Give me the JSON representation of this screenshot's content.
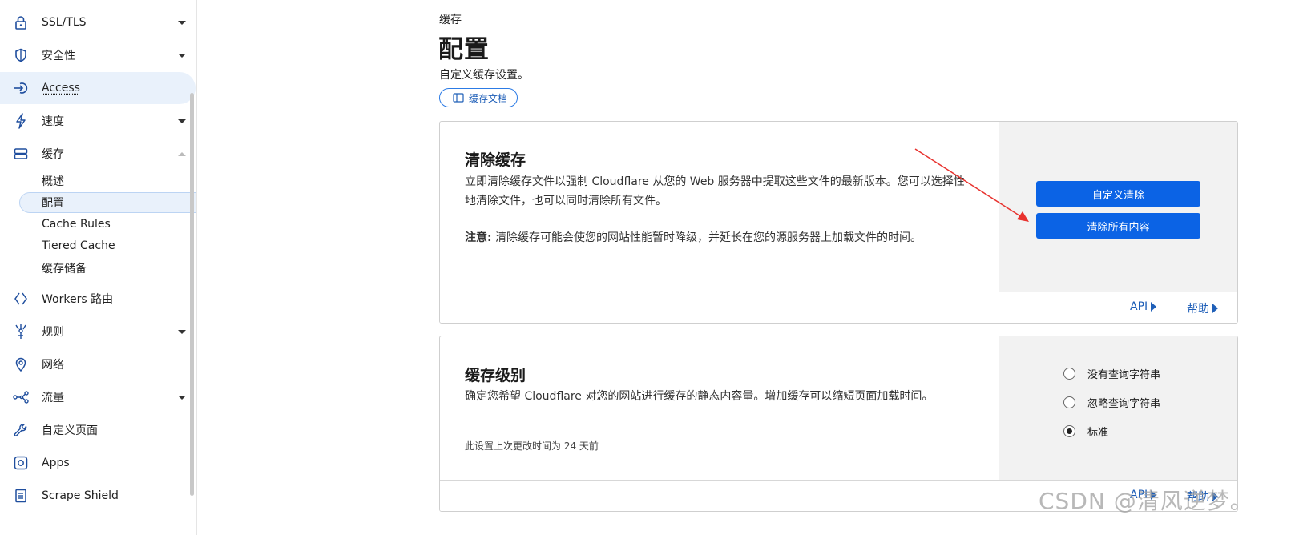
{
  "sidebar": {
    "items": [
      {
        "label": "SSL/TLS",
        "icon": "lock-icon",
        "caret": "down"
      },
      {
        "label": "安全性",
        "icon": "shield-icon",
        "caret": "down"
      },
      {
        "label": "Access",
        "icon": "access-icon",
        "caret": "none",
        "active": true
      },
      {
        "label": "速度",
        "icon": "lightning-icon",
        "caret": "down"
      },
      {
        "label": "缓存",
        "icon": "cache-drive-icon",
        "caret": "up"
      },
      {
        "label": "Workers 路由",
        "icon": "workers-icon",
        "caret": "none"
      },
      {
        "label": "规则",
        "icon": "rules-icon",
        "caret": "down"
      },
      {
        "label": "网络",
        "icon": "location-pin-icon",
        "caret": "none"
      },
      {
        "label": "流量",
        "icon": "traffic-icon",
        "caret": "down"
      },
      {
        "label": "自定义页面",
        "icon": "wrench-icon",
        "caret": "none"
      },
      {
        "label": "Apps",
        "icon": "apps-icon",
        "caret": "none"
      },
      {
        "label": "Scrape Shield",
        "icon": "document-icon",
        "caret": "none"
      }
    ],
    "cache_subitems": [
      {
        "label": "概述"
      },
      {
        "label": "配置",
        "selected": true
      },
      {
        "label": "Cache Rules"
      },
      {
        "label": "Tiered Cache"
      },
      {
        "label": "缓存储备"
      }
    ]
  },
  "header": {
    "breadcrumb": "缓存",
    "title": "配置",
    "description": "自定义缓存设置。",
    "docs_button": "缓存文档"
  },
  "purge_card": {
    "title": "清除缓存",
    "description": "立即清除缓存文件以强制 Cloudflare 从您的 Web 服务器中提取这些文件的最新版本。您可以选择性地清除文件，也可以同时清除所有文件。",
    "note_label": "注意:",
    "note_text": "清除缓存可能会使您的网站性能暂时降级，并延长在您的源服务器上加载文件的时间。",
    "custom_purge_button": "自定义清除",
    "purge_all_button": "清除所有内容",
    "api_link": "API",
    "help_link": "帮助"
  },
  "cache_level_card": {
    "title": "缓存级别",
    "description": "确定您希望 Cloudflare 对您的网站进行缓存的静态内容量。增加缓存可以缩短页面加载时间。",
    "last_changed": "此设置上次更改时间为 24 天前",
    "options": [
      {
        "label": "没有查询字符串",
        "selected": false
      },
      {
        "label": "忽略查询字符串",
        "selected": false
      },
      {
        "label": "标准",
        "selected": true
      }
    ],
    "api_link": "API",
    "help_link": "帮助"
  },
  "watermark": "CSDN @清风逆梦。",
  "colors": {
    "accent": "#0b63e5",
    "link": "#1f5fb8",
    "arrow": "#e8322e",
    "side_panel": "#f2f2f2"
  }
}
